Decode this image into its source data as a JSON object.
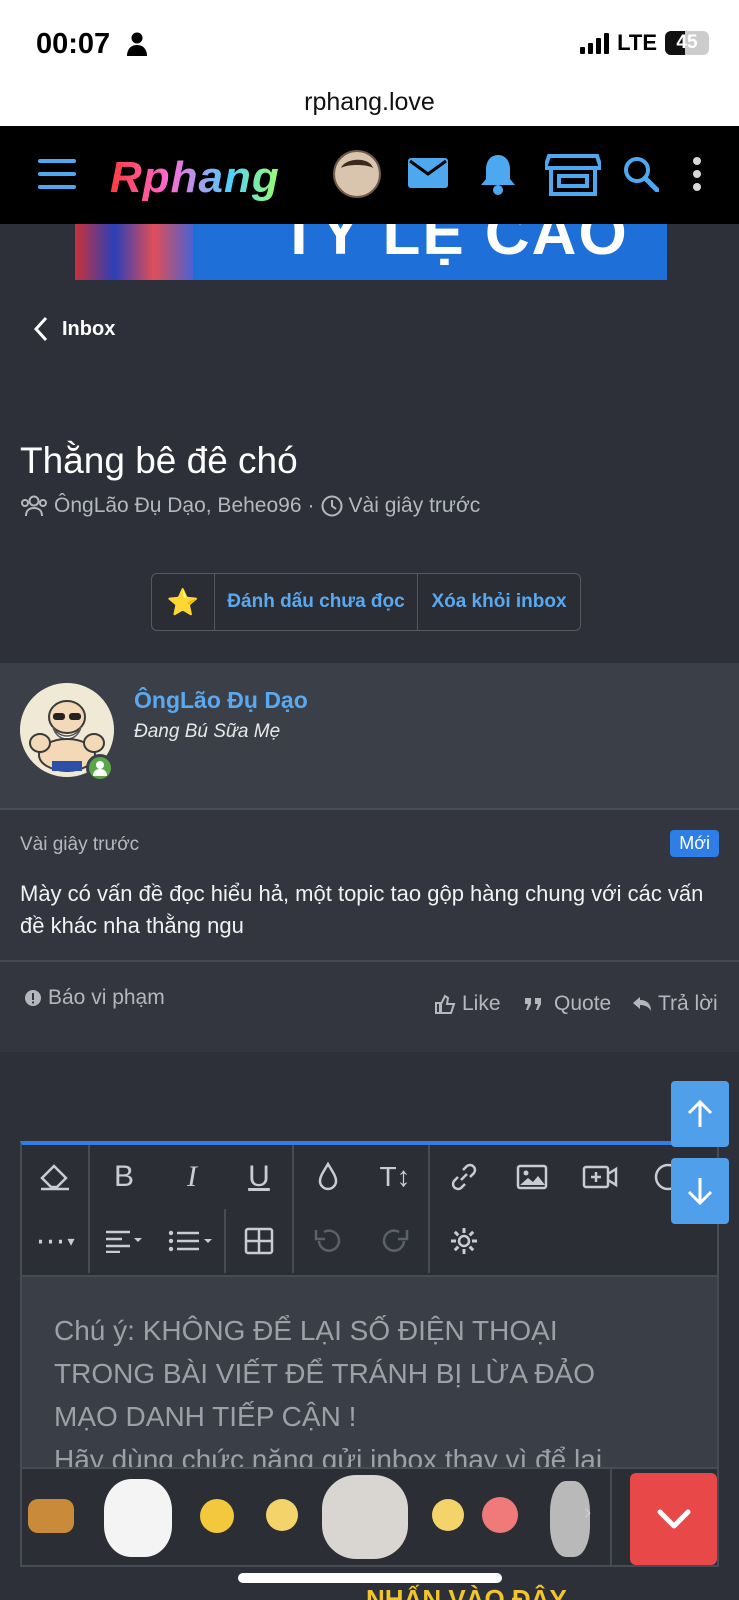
{
  "status_bar": {
    "time": "00:07",
    "network": "LTE",
    "battery": "45"
  },
  "browser": {
    "url": "rphang.love"
  },
  "navbar": {
    "logo": "Rphang",
    "icons": [
      "menu-icon",
      "avatar-icon",
      "mail-icon",
      "bell-icon",
      "shop-icon",
      "search-icon",
      "more-vertical-icon"
    ]
  },
  "banner": {
    "text": "TỶ LỆ CAO"
  },
  "breadcrumb": {
    "back_label": "Inbox"
  },
  "conversation": {
    "title": "Thằng bê đê chó",
    "participants": "ÔngLão Đụ Dạo, Beheo96",
    "separator": "·",
    "time": "Vài giây trước"
  },
  "actions": {
    "star": "⭐",
    "mark_unread": "Đánh dấu chưa đọc",
    "remove_inbox": "Xóa khỏi inbox"
  },
  "post": {
    "author": "ÔngLão Đụ Dạo",
    "author_title": "Đang Bú Sữa Mẹ",
    "time": "Vài giây trước",
    "badge": "Mới",
    "message": "Mày có vấn đề đọc hiểu hả, một topic tao gộp hàng chung với các vấn đề khác nha thằng ngu",
    "report": "Báo vi phạm",
    "like": "Like",
    "quote": "Quote",
    "reply": "Trả lời"
  },
  "editor": {
    "placeholder_line1": "Chú ý: KHÔNG ĐỂ LẠI SỐ ĐIỆN THOẠI",
    "placeholder_line2": "TRONG BÀI VIẾT ĐỂ TRÁNH BỊ LỪA ĐẢO",
    "placeholder_line3": "MẠO DANH TIẾP CẬN !",
    "placeholder_line4": "Hãy dùng chức năng gửi inbox thay vì để lại",
    "bold": "B",
    "italic": "I",
    "underline": "U",
    "text_size": "T↕",
    "more": "⋯"
  },
  "emoji_bar": {
    "next": "›"
  },
  "footer_text": "NHẤN VÀO ĐÂY"
}
